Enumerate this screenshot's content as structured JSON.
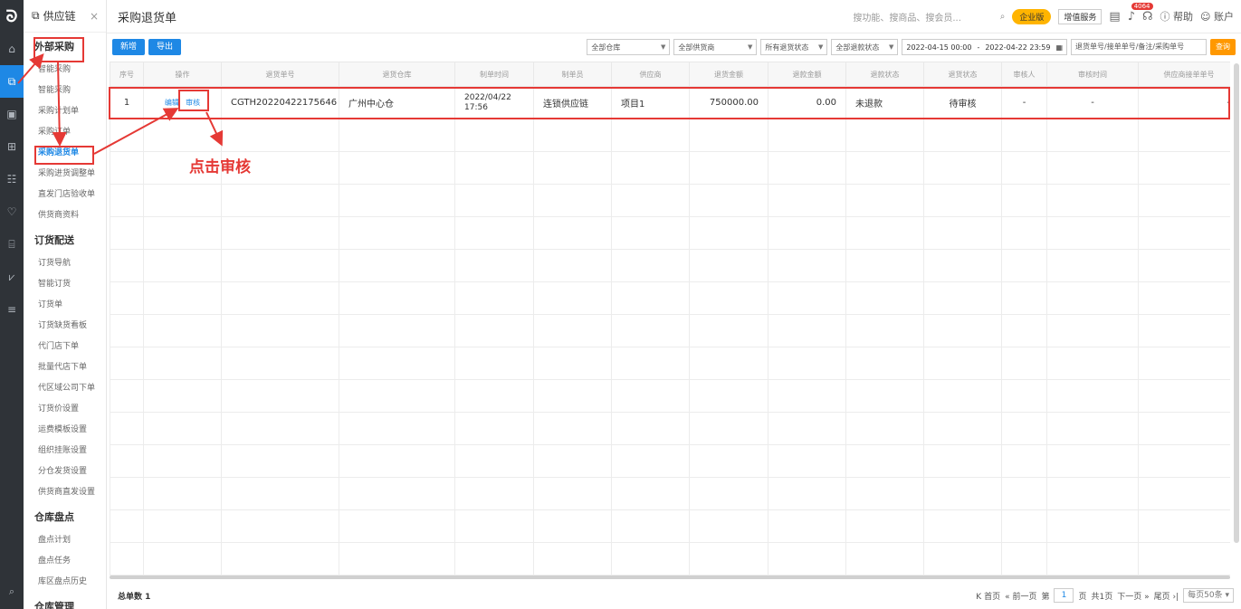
{
  "app": {
    "logo": "ᘐ",
    "module_title": "供应链",
    "close": "×"
  },
  "rail": {
    "bottom_icon": "search-list-icon"
  },
  "sidebar": {
    "groups": [
      {
        "title": "外部采购",
        "items": [
          "智能采购",
          "智能采购",
          "采购计划单",
          "采购订单",
          "采购退货单",
          "采购进货调整单",
          "直发门店验收单",
          "供货商资料"
        ]
      },
      {
        "title": "订货配送",
        "items": [
          "订货导航",
          "智能订货",
          "订货单",
          "订货缺货看板",
          "代门店下单",
          "批量代店下单",
          "代区域公司下单",
          "订货价设置",
          "运费模板设置",
          "组织挂账设置",
          "分仓发货设置",
          "供货商直发设置"
        ]
      },
      {
        "title": "仓库盘点",
        "items": [
          "盘点计划",
          "盘点任务",
          "库区盘点历史"
        ]
      },
      {
        "title": "仓库管理",
        "items": []
      }
    ]
  },
  "topbar": {
    "page_title": "采购退货单",
    "search_placeholder": "搜功能、搜商品、搜会员...",
    "enterprise": "企业版",
    "service": "增值服务",
    "notify_count": "4064",
    "help": "帮助",
    "account": "账户"
  },
  "toolbar": {
    "add": "新增",
    "export": "导出",
    "warehouse": "全部仓库",
    "supplier": "全部供货商",
    "return_status": "所有退货状态",
    "refund_status": "全部退款状态",
    "date_from": "2022-04-15 00:00",
    "date_sep": "-",
    "date_to": "2022-04-22 23:59",
    "keyword_placeholder": "退货单号/接单单号/备注/采购单号",
    "query": "查询"
  },
  "table": {
    "headers": [
      "序号",
      "操作",
      "退货单号",
      "退货仓库",
      "制单时间",
      "制单员",
      "供应商",
      "退货金额",
      "退款金额",
      "退款状态",
      "退货状态",
      "审核人",
      "审核时间",
      "供应商接单单号"
    ],
    "row": {
      "index": "1",
      "edit": "编辑",
      "audit": "审核",
      "order_no": "CGTH20220422175646",
      "warehouse": "广州中心仓",
      "created": "2022/04/22 17:56",
      "creator": "连锁供应链",
      "supplier": "项目1",
      "return_amount": "750000.00",
      "refund_amount": "0.00",
      "refund_status": "未退款",
      "return_status": "待审核",
      "auditor": "-",
      "audit_time": "-",
      "supplier_order": "-"
    }
  },
  "footer": {
    "total": "总单数 1",
    "first": "首页",
    "prev": "前一页",
    "page_label_pre": "第",
    "page": "1",
    "page_label_post": "页",
    "total_pages": "共1页",
    "next": "下一页",
    "last": "尾页",
    "page_size": "每页50条"
  },
  "annotation": {
    "text": "点击审核",
    "color": "#e53935"
  }
}
